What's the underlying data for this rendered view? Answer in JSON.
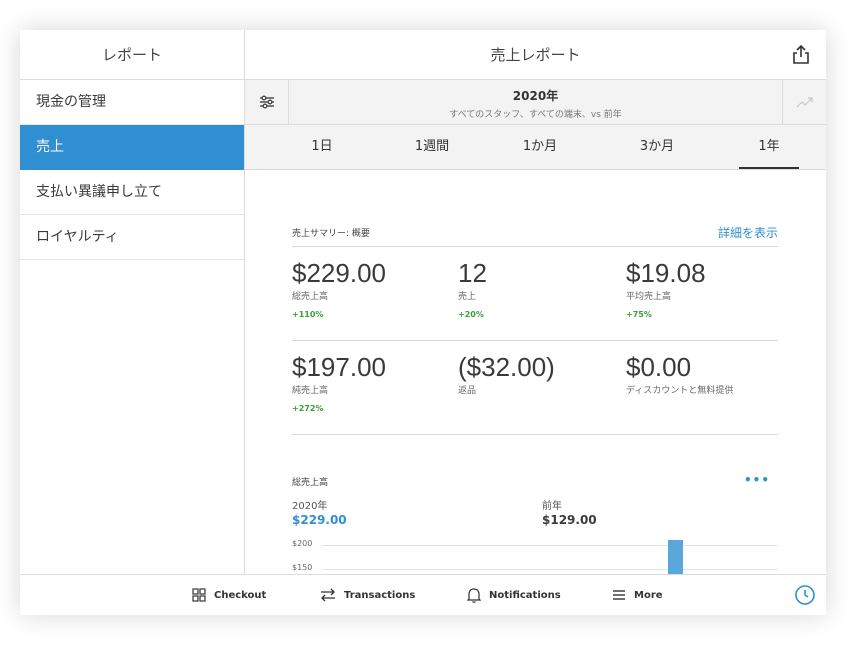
{
  "sidebar": {
    "title": "レポート",
    "items": [
      {
        "label": "現金の管理",
        "active": false
      },
      {
        "label": "売上",
        "active": true
      },
      {
        "label": "支払い異議申し立て",
        "active": false
      },
      {
        "label": "ロイヤルティ",
        "active": false
      }
    ]
  },
  "header": {
    "title": "売上レポート",
    "share_icon": "share-icon"
  },
  "filter": {
    "year": "2020年",
    "subtitle": "すべてのスタッフ、すべての端末、vs 前年",
    "settings_icon": "sliders-icon",
    "trend_icon": "trend-icon"
  },
  "tabs": [
    {
      "label": "1日",
      "active": false
    },
    {
      "label": "1週間",
      "active": false
    },
    {
      "label": "1か月",
      "active": false
    },
    {
      "label": "3か月",
      "active": false
    },
    {
      "label": "1年",
      "active": true
    }
  ],
  "summary": {
    "title": "売上サマリー: 概要",
    "detail_link": "詳細を表示",
    "metrics": [
      {
        "value": "$229.00",
        "label": "総売上高",
        "change": "+110%"
      },
      {
        "value": "12",
        "label": "売上",
        "change": "+20%"
      },
      {
        "value": "$19.08",
        "label": "平均売上高",
        "change": "+75%"
      },
      {
        "value": "$197.00",
        "label": "純売上高",
        "change": "+272%"
      },
      {
        "value": "($32.00)",
        "label": "返品",
        "change": ""
      },
      {
        "value": "$0.00",
        "label": "ディスカウントと無料提供",
        "change": ""
      }
    ]
  },
  "chart": {
    "title": "総売上高",
    "more": "•••",
    "current_label": "2020年",
    "current_value": "$229.00",
    "previous_label": "前年",
    "previous_value": "$129.00",
    "y_ticks": [
      "$200",
      "$150"
    ]
  },
  "chart_data": {
    "type": "bar",
    "title": "総売上高",
    "y_ticks": [
      200,
      150
    ],
    "ylim": [
      150,
      200
    ],
    "series": [
      {
        "values": [
          210
        ]
      }
    ],
    "grid": true
  },
  "bottom_nav": {
    "items": [
      {
        "label": "Checkout",
        "icon": "grid-icon"
      },
      {
        "label": "Transactions",
        "icon": "swap-arrows-icon"
      },
      {
        "label": "Notifications",
        "icon": "bell-icon"
      },
      {
        "label": "More",
        "icon": "menu-icon"
      }
    ],
    "clock_icon": "clock-icon"
  },
  "colors": {
    "accent": "#2f8fd1",
    "positive": "#3aa13a",
    "bar": "#5aa7dc"
  }
}
